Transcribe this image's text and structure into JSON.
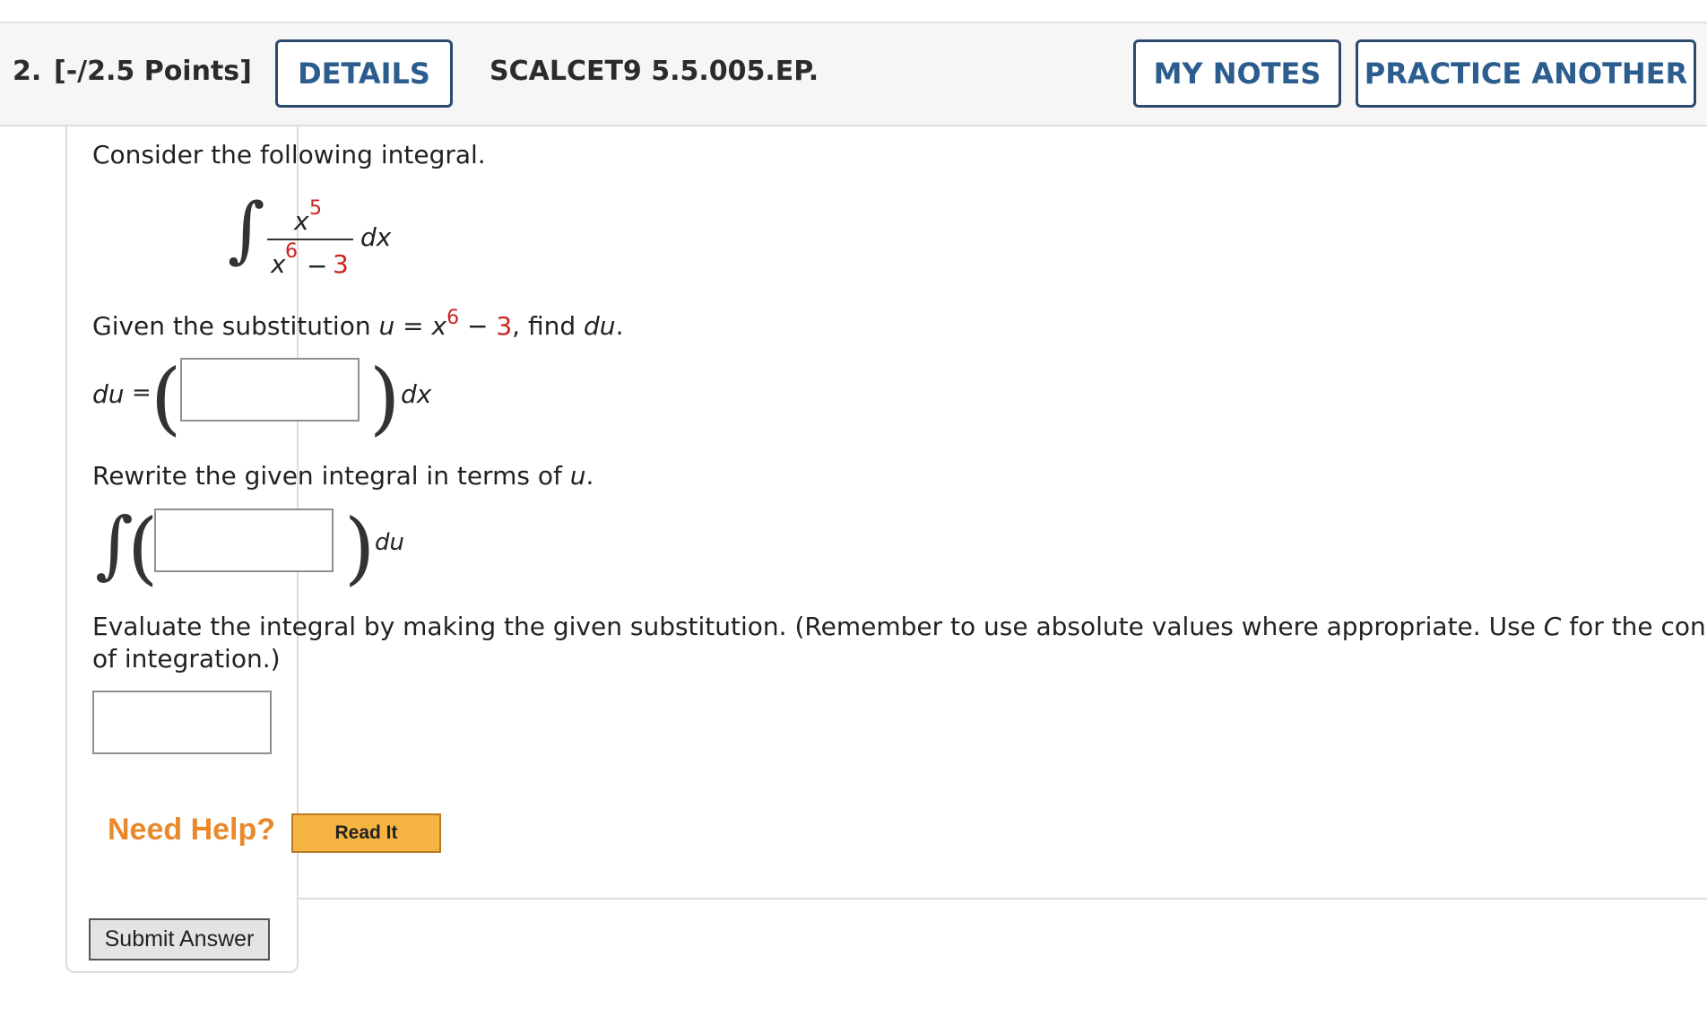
{
  "header": {
    "number": "2.",
    "points": "[-/2.5 Points]",
    "details_label": "DETAILS",
    "problem_code": "SCALCET9 5.5.005.EP.",
    "my_notes_label": "MY NOTES",
    "practice_label": "PRACTICE ANOTHER"
  },
  "problem": {
    "intro": "Consider the following integral.",
    "integrand": {
      "numerator_base": "x",
      "numerator_exp": "5",
      "denominator_base": "x",
      "denominator_exp": "6",
      "denominator_op": "−",
      "denominator_const": "3",
      "differential": "dx"
    },
    "sub_prefix": "Given the substitution ",
    "sub_u": "u",
    "sub_eq": " = ",
    "sub_x": "x",
    "sub_exp": "6",
    "sub_minus": " − ",
    "sub_const": "3",
    "sub_mid": ", find ",
    "sub_du": "du",
    "sub_end": ".",
    "du_label": "du",
    "du_eq": "=",
    "dx_label": "dx",
    "rewrite_prefix": "Rewrite the given integral in terms of ",
    "rewrite_u": "u",
    "rewrite_end": ".",
    "du_suffix": "du",
    "evaluate_line1_prefix": "Evaluate the integral by making the given substitution. (Remember to use absolute values where appropriate. Use ",
    "evaluate_C": "C",
    "evaluate_line1_suffix": " for the constant",
    "evaluate_line2": "of integration.)"
  },
  "inputs": {
    "du_value": "",
    "integral_value": "",
    "answer_value": ""
  },
  "help": {
    "need_help": "Need Help?",
    "read_it": "Read It"
  },
  "submit_label": "Submit Answer",
  "colors": {
    "accent_blue": "#2c5d8f",
    "red": "#cc2222",
    "help_orange": "#e8892b",
    "read_it_bg": "#f6b443"
  }
}
